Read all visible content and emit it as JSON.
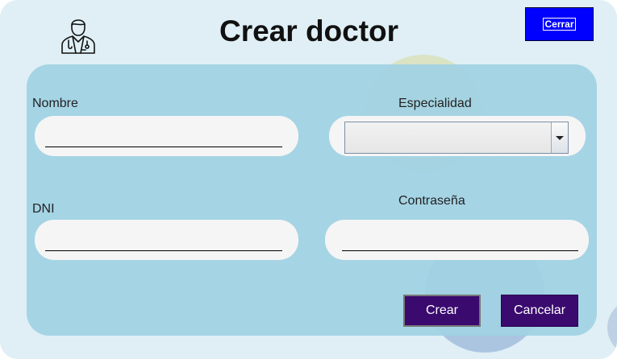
{
  "title": "Crear doctor",
  "close_label": "Cerrar",
  "fields": {
    "nombre": {
      "label": "Nombre",
      "value": "",
      "placeholder": ""
    },
    "especialidad": {
      "label": "Especialidad",
      "selected": ""
    },
    "dni": {
      "label": "DNI",
      "value": "",
      "placeholder": ""
    },
    "contrasena": {
      "label": "Contraseña",
      "value": "",
      "placeholder": ""
    }
  },
  "buttons": {
    "create": "Crear",
    "cancel": "Cancelar"
  },
  "colors": {
    "close_bg": "#0000ff",
    "button_bg": "#3a0a6e",
    "panel_bg": "#a6d4e4",
    "window_bg": "#dfeff5"
  },
  "icons": {
    "header": "doctor-icon",
    "dropdown": "chevron-down-icon"
  }
}
